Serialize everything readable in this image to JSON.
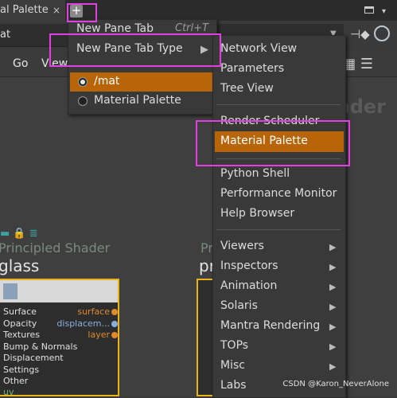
{
  "tabbar": {
    "tab_label": "al Palette",
    "close_glyph": "×",
    "add_glyph": "+"
  },
  "pathbar": {
    "path": "at"
  },
  "menubar": {
    "go": "Go",
    "view": "View"
  },
  "menu1": {
    "new_pane_tab": "New Pane Tab",
    "new_pane_tab_shortcut": "Ctrl+T",
    "new_pane_tab_type": "New Pane Tab Type",
    "mat": "/mat",
    "material_palette": "Material Palette"
  },
  "menu2": {
    "items": [
      "Network View",
      "Parameters",
      "Tree View",
      "Render Scheduler",
      "Material Palette",
      "Python Shell",
      "Performance Monitor",
      "Help Browser",
      "Viewers",
      "Inspectors",
      "Animation",
      "Solaris",
      "Mantra Rendering",
      "TOPs",
      "Misc",
      "Labs"
    ]
  },
  "network": {
    "bg_label": "hader",
    "node1": {
      "type": "Principled Shader",
      "name": "glass",
      "inputs": [
        "Surface",
        "Opacity",
        "Textures",
        "Bump & Normals",
        "Displacement",
        "Settings",
        "Other"
      ],
      "outputs": [
        "surface",
        "displacem...",
        "layer"
      ],
      "bottom": "uv"
    },
    "node2": {
      "type_prefix": "Pri",
      "name_prefix": "pr"
    }
  },
  "watermark": "CSDN @Karon_NeverAlone",
  "colors": {
    "highlight": "#b8650a",
    "node_border": "#e9b31a",
    "annotation": "#e040e0"
  }
}
